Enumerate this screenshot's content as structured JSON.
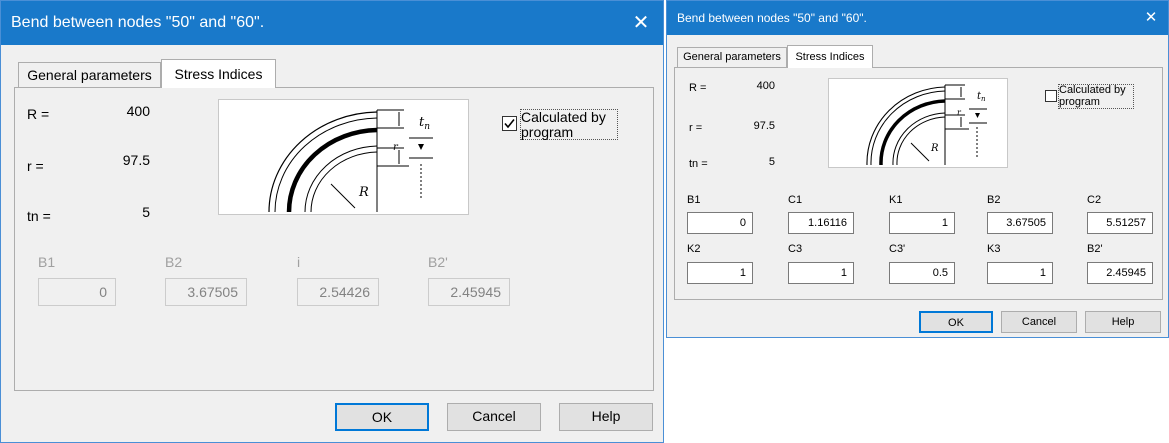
{
  "dialog_left": {
    "title": "Bend between nodes \"50\" and \"60\".",
    "close_glyph": "✕",
    "tabs": [
      "General parameters",
      "Stress Indices"
    ],
    "params": [
      {
        "label": "R =",
        "value": "400"
      },
      {
        "label": "r =",
        "value": "97.5"
      },
      {
        "label": "tn =",
        "value": "5"
      }
    ],
    "checkbox": {
      "label": "Calculated by program",
      "checked": true
    },
    "fields": [
      {
        "label": "B1",
        "value": "0"
      },
      {
        "label": "B2",
        "value": "3.67505"
      },
      {
        "label": "i",
        "value": "2.54426"
      },
      {
        "label": "B2'",
        "value": "2.45945"
      }
    ],
    "buttons": {
      "ok": "OK",
      "cancel": "Cancel",
      "help": "Help"
    },
    "diagram_labels": {
      "tn": "tn",
      "r": "r",
      "R": "R"
    }
  },
  "dialog_right": {
    "title": "Bend between nodes \"50\" and \"60\".",
    "close_glyph": "✕",
    "tabs": [
      "General parameters",
      "Stress Indices"
    ],
    "params": [
      {
        "label": "R =",
        "value": "400"
      },
      {
        "label": "r =",
        "value": "97.5"
      },
      {
        "label": "tn =",
        "value": "5"
      }
    ],
    "checkbox": {
      "label": "Calculated by program",
      "checked": false
    },
    "fields_row1": [
      {
        "label": "B1",
        "value": "0"
      },
      {
        "label": "C1",
        "value": "1.16116"
      },
      {
        "label": "K1",
        "value": "1"
      },
      {
        "label": "B2",
        "value": "3.67505"
      },
      {
        "label": "C2",
        "value": "5.51257"
      }
    ],
    "fields_row2": [
      {
        "label": "K2",
        "value": "1"
      },
      {
        "label": "C3",
        "value": "1"
      },
      {
        "label": "C3'",
        "value": "0.5"
      },
      {
        "label": "K3",
        "value": "1"
      },
      {
        "label": "B2'",
        "value": "2.45945"
      }
    ],
    "buttons": {
      "ok": "OK",
      "cancel": "Cancel",
      "help": "Help"
    },
    "diagram_labels": {
      "tn": "tn",
      "r": "r",
      "R": "R"
    }
  }
}
